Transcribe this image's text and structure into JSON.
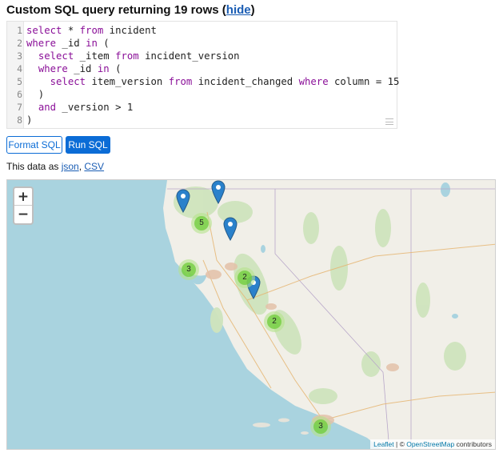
{
  "header": {
    "title_prefix": "Custom SQL query returning 19 rows (",
    "hide_link": "hide",
    "title_suffix": ")"
  },
  "editor": {
    "line_numbers": [
      "1",
      "2",
      "3",
      "4",
      "5",
      "6",
      "7",
      "8"
    ]
  },
  "buttons": {
    "format": "Format SQL",
    "run": "Run SQL"
  },
  "export": {
    "prefix": "This data as ",
    "json": "json",
    "separator": ", ",
    "csv": "CSV"
  },
  "map": {
    "zoom_in": "+",
    "zoom_out": "−",
    "clusters": [
      "5",
      "3",
      "2",
      "2",
      "3"
    ],
    "attribution": {
      "leaflet": "Leaflet",
      "sep": " | © ",
      "osm": "OpenStreetMap",
      "suffix": " contributors"
    },
    "colors": {
      "water": "#a9d3df",
      "land": "#f1efe8",
      "marker": "#2a81cb"
    }
  }
}
